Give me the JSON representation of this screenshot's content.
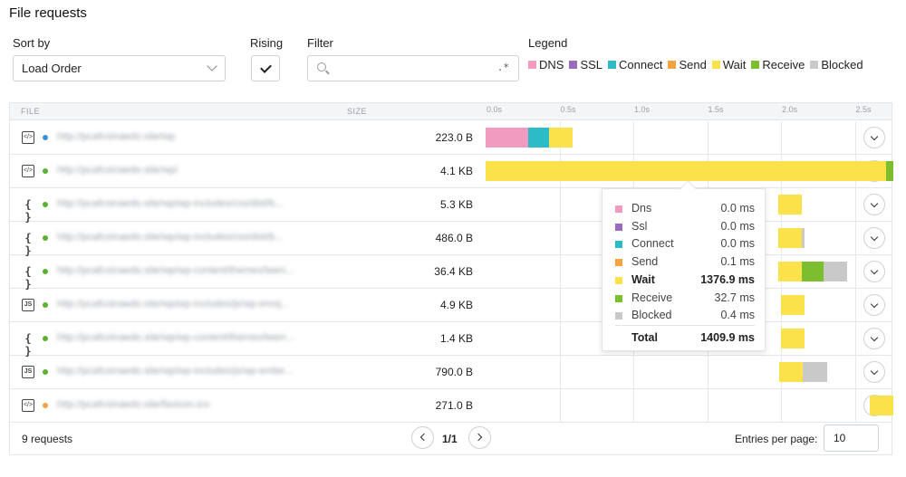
{
  "page": {
    "title": "File requests"
  },
  "controls": {
    "sort_label": "Sort by",
    "sort_value": "Load Order",
    "rising_label": "Rising",
    "rising_checked": true,
    "filter_label": "Filter",
    "filter_value": "",
    "filter_regex_glyph": ".*",
    "legend_label": "Legend"
  },
  "legend": [
    {
      "label": "DNS",
      "color": "#f29bc1"
    },
    {
      "label": "SSL",
      "color": "#9b6bbd"
    },
    {
      "label": "Connect",
      "color": "#2bbcc8"
    },
    {
      "label": "Send",
      "color": "#f4a340"
    },
    {
      "label": "Wait",
      "color": "#fbe24b"
    },
    {
      "label": "Receive",
      "color": "#7cbf2e"
    },
    {
      "label": "Blocked",
      "color": "#c9c9c9"
    }
  ],
  "table": {
    "col_file": "FILE",
    "col_size": "SIZE",
    "time_ticks": [
      "0.0s",
      "0.5s",
      "1.0s",
      "1.5s",
      "2.0s",
      "2.5s"
    ],
    "rows": [
      {
        "icon": "html-file-icon",
        "status_color": "#3b8fe0",
        "url": "http://pcafcoinaedo.site/wp",
        "size": "223.0 B",
        "timings": {
          "dns": 0.29,
          "ssl": 0,
          "connect": 0.14,
          "send": 0,
          "wait": 0.16,
          "receive": 0,
          "blocked": 0,
          "start": 0.0
        }
      },
      {
        "icon": "html-file-icon",
        "status_color": "#5bb131",
        "url": "http://pcafcoinaedo.site/wp/",
        "size": "4.1 KB",
        "timings": {
          "dns": 0,
          "ssl": 0,
          "connect": 0,
          "send": 0.0001,
          "wait": 1.3769,
          "receive": 0.0327,
          "blocked": 0.0004,
          "start": 0.0
        }
      },
      {
        "icon": "css-file-icon",
        "status_color": "#5bb131",
        "url": "http://pcafcoinaedo.site/wp/wp-includes/css/dist/b...",
        "size": "5.3 KB",
        "timings": {
          "dns": 0,
          "ssl": 0,
          "connect": 0,
          "send": 0,
          "wait": 0.16,
          "receive": 0,
          "blocked": 0,
          "start": 1.98
        }
      },
      {
        "icon": "css-file-icon",
        "status_color": "#5bb131",
        "url": "http://pcafcoinaedo.site/wp/wp-includes/css/dist/b...",
        "size": "486.0 B",
        "timings": {
          "dns": 0,
          "ssl": 0,
          "connect": 0,
          "send": 0,
          "wait": 0.16,
          "receive": 0,
          "blocked": 0.02,
          "start": 1.98
        }
      },
      {
        "icon": "css-file-icon",
        "status_color": "#5bb131",
        "url": "http://pcafcoinaedo.site/wp/wp-content/themes/twen...",
        "size": "36.4 KB",
        "timings": {
          "dns": 0,
          "ssl": 0,
          "connect": 0,
          "send": 0,
          "wait": 0.16,
          "receive": 0.15,
          "blocked": 0.16,
          "start": 1.98
        }
      },
      {
        "icon": "js-file-icon",
        "status_color": "#5bb131",
        "url": "http://pcafcoinaedo.site/wp/wp-includes/js/wp-emoj...",
        "size": "4.9 KB",
        "timings": {
          "dns": 0,
          "ssl": 0,
          "connect": 0,
          "send": 0,
          "wait": 0.16,
          "receive": 0,
          "blocked": 0,
          "start": 2.0
        }
      },
      {
        "icon": "css-file-icon",
        "status_color": "#5bb131",
        "url": "http://pcafcoinaedo.site/wp/wp-content/themes/twen...",
        "size": "1.4 KB",
        "timings": {
          "dns": 0,
          "ssl": 0,
          "connect": 0,
          "send": 0,
          "wait": 0.16,
          "receive": 0,
          "blocked": 0,
          "start": 2.0
        }
      },
      {
        "icon": "js-file-icon",
        "status_color": "#5bb131",
        "url": "http://pcafcoinaedo.site/wp/wp-includes/js/wp-embe...",
        "size": "790.0 B",
        "timings": {
          "dns": 0,
          "ssl": 0,
          "connect": 0,
          "send": 0,
          "wait": 0.16,
          "receive": 0,
          "blocked": 0.16,
          "start": 1.99
        }
      },
      {
        "icon": "html-file-icon",
        "status_color": "#f4a340",
        "url": "http://pcafcoinaedo.site/favicon.ico",
        "size": "271.0 B",
        "timings": {
          "dns": 0,
          "ssl": 0,
          "connect": 0,
          "send": 0,
          "wait": 0.16,
          "receive": 0,
          "blocked": 0,
          "start": 2.6
        }
      }
    ],
    "timeline_max_seconds": 2.75,
    "active_row": 1
  },
  "tooltip": {
    "items": [
      {
        "name": "Dns",
        "value": "0.0 ms",
        "color": "#f29bc1",
        "bold": false
      },
      {
        "name": "Ssl",
        "value": "0.0 ms",
        "color": "#9b6bbd",
        "bold": false
      },
      {
        "name": "Connect",
        "value": "0.0 ms",
        "color": "#2bbcc8",
        "bold": false
      },
      {
        "name": "Send",
        "value": "0.1 ms",
        "color": "#f4a340",
        "bold": false
      },
      {
        "name": "Wait",
        "value": "1376.9 ms",
        "color": "#fbe24b",
        "bold": true
      },
      {
        "name": "Receive",
        "value": "32.7 ms",
        "color": "#7cbf2e",
        "bold": false
      },
      {
        "name": "Blocked",
        "value": "0.4 ms",
        "color": "#c9c9c9",
        "bold": false
      }
    ],
    "total_label": "Total",
    "total_value": "1409.9 ms"
  },
  "footer": {
    "count": "9 requests",
    "page": "1/1",
    "entries_label": "Entries per page:",
    "entries_value": "10"
  }
}
